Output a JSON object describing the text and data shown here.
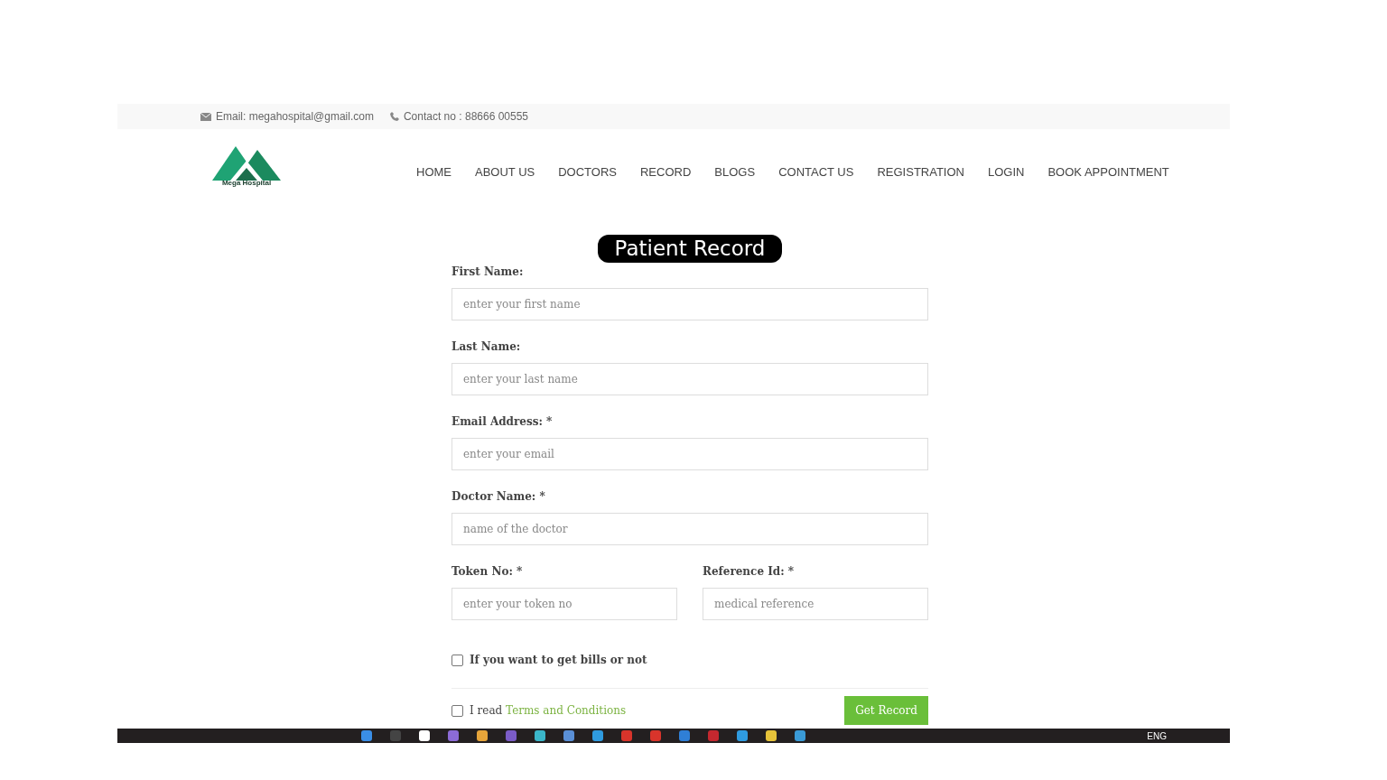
{
  "top_bar": {
    "email": "Email: megahospital@gmail.com",
    "contact": "Contact no : 88666 00555"
  },
  "logo": {
    "text": "Mega Hospital"
  },
  "nav": [
    {
      "label": "HOME"
    },
    {
      "label": "ABOUT US"
    },
    {
      "label": "DOCTORS"
    },
    {
      "label": "RECORD"
    },
    {
      "label": "BLOGS"
    },
    {
      "label": "CONTACT US"
    },
    {
      "label": "REGISTRATION"
    },
    {
      "label": "LOGIN"
    },
    {
      "label": "BOOK APPOINTMENT"
    }
  ],
  "form": {
    "title": "Patient Record",
    "fields": [
      {
        "label": "First Name:",
        "placeholder": "enter your first name"
      },
      {
        "label": "Last Name:",
        "placeholder": "enter your last name"
      },
      {
        "label": "Email Address: *",
        "placeholder": "enter your email"
      },
      {
        "label": "Doctor Name: *",
        "placeholder": "name of the doctor"
      }
    ],
    "field_pair": [
      {
        "label": "Token No: *",
        "placeholder": "enter your token no"
      },
      {
        "label": "Reference Id: *",
        "placeholder": "medical reference"
      }
    ],
    "bills": {
      "label": "If you want to get bills or not",
      "checked": false
    },
    "terms": {
      "prefix": "I read",
      "link": "Terms and Conditions",
      "checked": false
    },
    "submit": "Get Record"
  },
  "taskbar": {
    "language": "ENG"
  }
}
